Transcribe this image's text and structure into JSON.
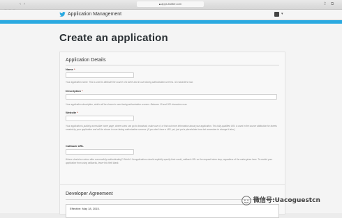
{
  "browser": {
    "address": "apps.twitter.com"
  },
  "header": {
    "title": "Application Management",
    "colors": {
      "accent": "#2aa9e0"
    }
  },
  "page": {
    "title": "Create an application"
  },
  "details": {
    "heading": "Application Details",
    "fields": {
      "name": {
        "label": "Name",
        "required_mark": "*",
        "value": "",
        "help": "Your application name. This is used to attribute the source of a tweet and in user-facing authorization screens. 32 characters max."
      },
      "description": {
        "label": "Description",
        "required_mark": "*",
        "value": "",
        "help": "Your application description, which will be shown in user-facing authorization screens. Between 10 and 200 characters max."
      },
      "website": {
        "label": "Website",
        "required_mark": "*",
        "value": "",
        "help": "Your application's publicly accessible home page, where users can go to download, make use of, or find out more information about your application. This fully-qualified URL is used in the source attribution for tweets created by your application and will be shown in user-facing authorization screens. (If you don't have a URL yet, just put a placeholder here but remember to change it later.)"
      },
      "callback": {
        "label": "Callback URL",
        "value": "",
        "help": "Where should we return after successfully authenticating? OAuth 1.0a applications should explicitly specify their oauth_callback URL on the request token step, regardless of the value given here. To restrict your application from using callbacks, leave this field blank."
      }
    }
  },
  "agreement": {
    "heading": "Developer Agreement",
    "effective": "Effective: May 18, 2015."
  },
  "watermark": {
    "text": "微信号:Uacoguestcn"
  }
}
